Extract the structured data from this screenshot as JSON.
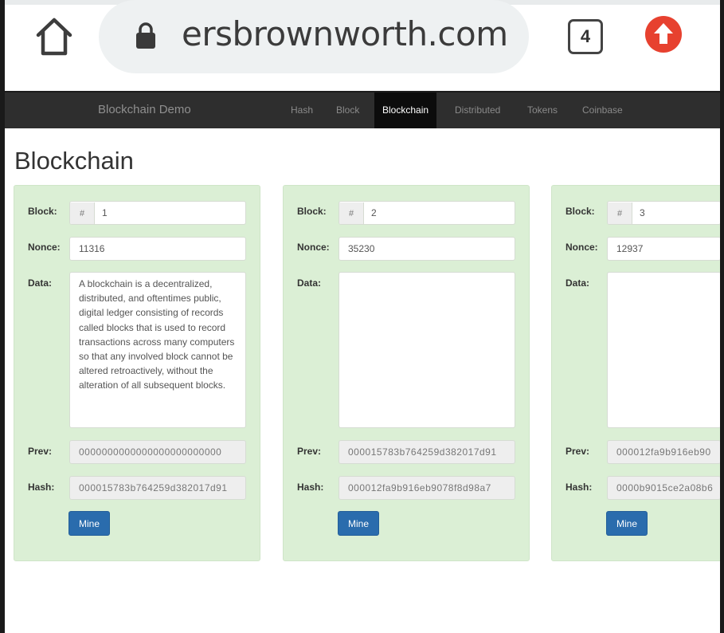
{
  "browser": {
    "url": "ersbrownworth.com",
    "tab_count": "4"
  },
  "navbar": {
    "brand": "Blockchain Demo",
    "items": [
      {
        "label": "Hash",
        "active": false
      },
      {
        "label": "Block",
        "active": false
      },
      {
        "label": "Blockchain",
        "active": true
      },
      {
        "label": "Distributed",
        "active": false
      },
      {
        "label": "Tokens",
        "active": false
      },
      {
        "label": "Coinbase",
        "active": false
      }
    ]
  },
  "page": {
    "title": "Blockchain"
  },
  "labels": {
    "block": "Block:",
    "nonce": "Nonce:",
    "data": "Data:",
    "prev": "Prev:",
    "hash": "Hash:",
    "mine": "Mine",
    "hash_prefix": "#"
  },
  "blocks": [
    {
      "number": "1",
      "nonce": "11316",
      "data": "A blockchain is a decentralized, distributed, and oftentimes public, digital ledger consisting of records called blocks that is used to record transactions across many computers so that any involved block cannot be altered retroactively, without the alteration of all subsequent blocks.",
      "prev": "0000000000000000000000000",
      "hash": "000015783b764259d382017d91"
    },
    {
      "number": "2",
      "nonce": "35230",
      "data": "",
      "prev": "000015783b764259d382017d91",
      "hash": "000012fa9b916eb9078f8d98a7"
    },
    {
      "number": "3",
      "nonce": "12937",
      "data": "",
      "prev": "000012fa9b916eb90",
      "hash": "0000b9015ce2a08b6"
    }
  ],
  "colors": {
    "navbar_bg": "#2e2e2e",
    "card_bg": "#dbefd5",
    "mine_button": "#2a6cad",
    "update_icon": "#e7412f"
  }
}
